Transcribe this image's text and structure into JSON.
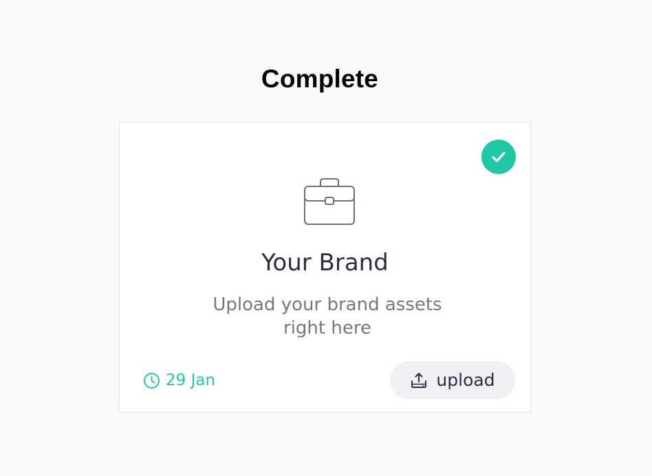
{
  "section": {
    "title": "Complete"
  },
  "card": {
    "title": "Your Brand",
    "description": "Upload your brand assets right here",
    "status": "complete",
    "icon": "briefcase-icon",
    "due_date": "29 Jan",
    "upload_label": "upload"
  },
  "colors": {
    "accent": "#1fc7a4",
    "title": "#2b2d42",
    "muted": "#74777c",
    "button_bg": "#eef0f3"
  }
}
